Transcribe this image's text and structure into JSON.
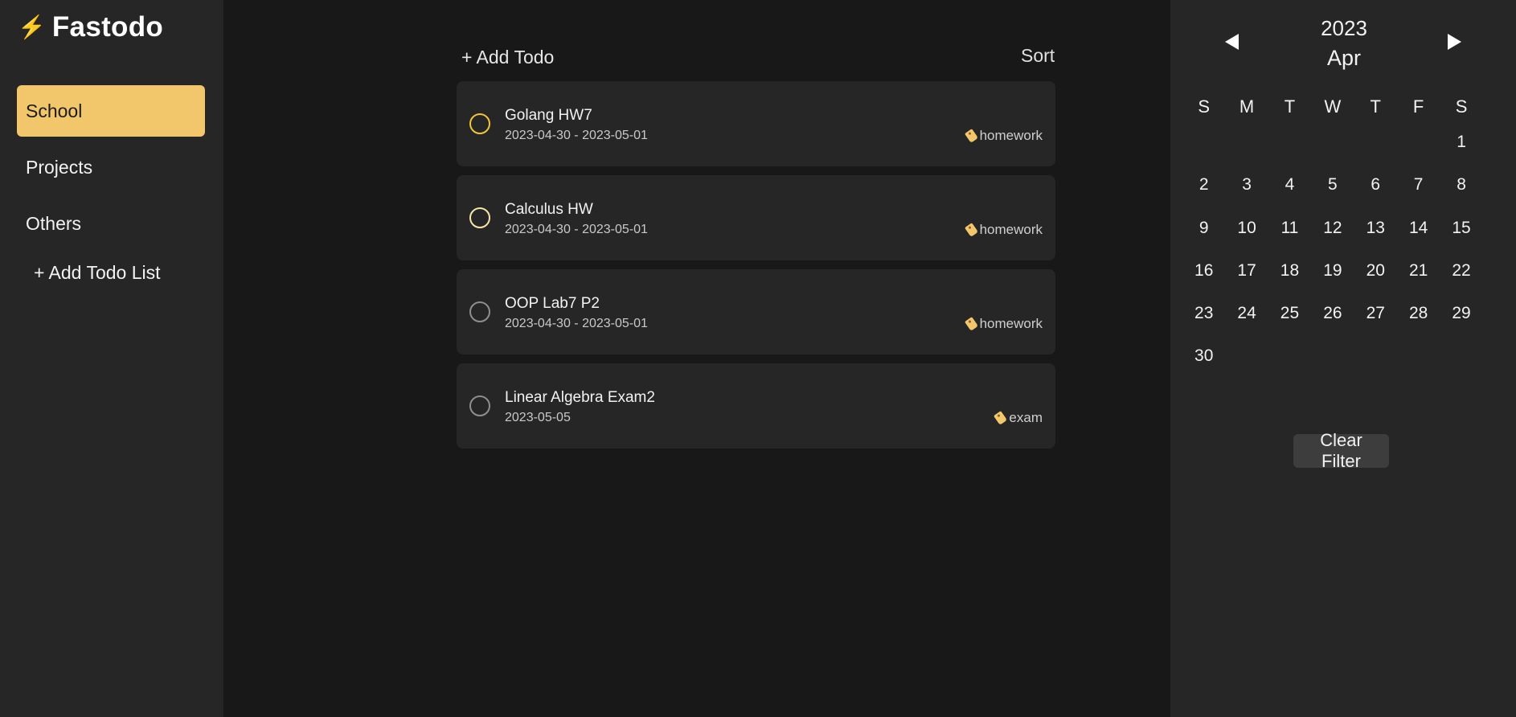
{
  "app": {
    "name": "Fastodo",
    "logo_icon": "lightning-icon",
    "logo_glyph": "⚡"
  },
  "sidebar": {
    "items": [
      {
        "label": "School",
        "active": true
      },
      {
        "label": "Projects",
        "active": false
      },
      {
        "label": "Others",
        "active": false
      }
    ],
    "add_list_label": "+ Add Todo List"
  },
  "main": {
    "add_todo_label": "+ Add Todo",
    "sort_label": "Sort",
    "todos": [
      {
        "title": "Golang HW7",
        "dates": "2023-04-30 - 2023-05-01",
        "tag": "homework",
        "status_color": "#f0c53c"
      },
      {
        "title": "Calculus HW",
        "dates": "2023-04-30 - 2023-05-01",
        "tag": "homework",
        "status_color": "#f5e6a8"
      },
      {
        "title": "OOP Lab7 P2",
        "dates": "2023-04-30 - 2023-05-01",
        "tag": "homework",
        "status_color": "#8e8e8e"
      },
      {
        "title": "Linear Algebra Exam2",
        "dates": "2023-05-05",
        "tag": "exam",
        "status_color": "#8e8e8e"
      }
    ]
  },
  "calendar": {
    "year": "2023",
    "month": "Apr",
    "prev_icon": "triangle-left-icon",
    "next_icon": "triangle-right-icon",
    "weekdays": [
      "S",
      "M",
      "T",
      "W",
      "T",
      "F",
      "S"
    ],
    "leading_blanks": 6,
    "days": [
      "1",
      "2",
      "3",
      "4",
      "5",
      "6",
      "7",
      "8",
      "9",
      "10",
      "11",
      "12",
      "13",
      "14",
      "15",
      "16",
      "17",
      "18",
      "19",
      "20",
      "21",
      "22",
      "23",
      "24",
      "25",
      "26",
      "27",
      "28",
      "29",
      "30"
    ],
    "clear_filter_label": "Clear Filter"
  },
  "colors": {
    "accent": "#f2c76b",
    "sidebar_bg": "#262626",
    "main_bg": "#181818",
    "card_bg": "#262626",
    "button_bg": "#3d3d3d"
  }
}
